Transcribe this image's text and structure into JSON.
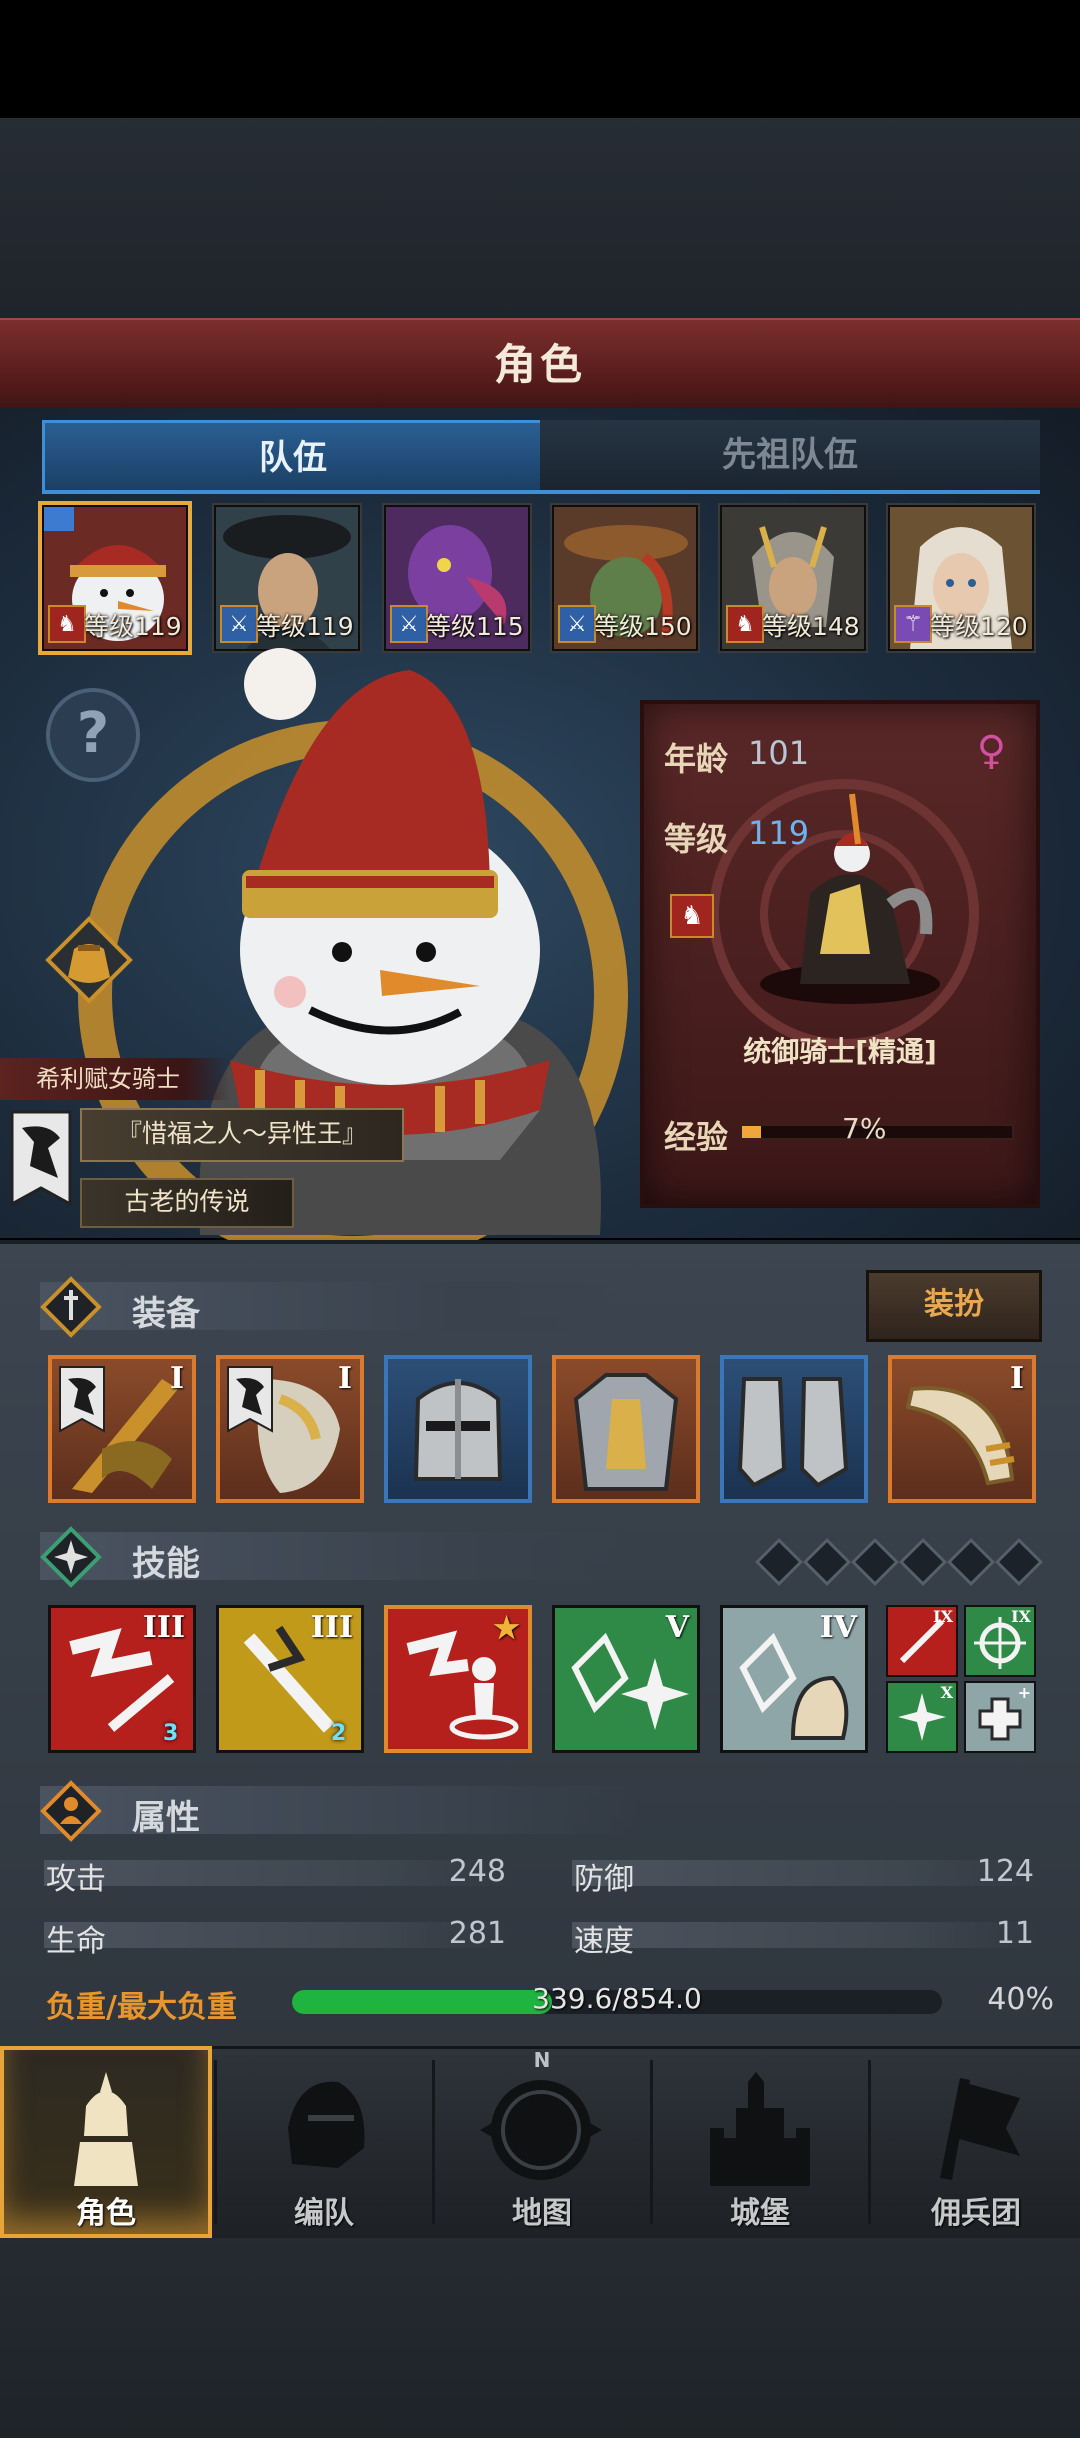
{
  "header": {
    "title": "角色"
  },
  "tabs": [
    {
      "label": "队伍",
      "active": true
    },
    {
      "label": "先祖队伍",
      "active": false
    }
  ],
  "team": [
    {
      "level_label": "等级119",
      "class_icon": "horse-icon",
      "selected": true
    },
    {
      "level_label": "等级119",
      "class_icon": "sword-icon"
    },
    {
      "level_label": "等级115",
      "class_icon": "sword-icon"
    },
    {
      "level_label": "等级150",
      "class_icon": "sword-icon"
    },
    {
      "level_label": "等级148",
      "class_icon": "horse-icon"
    },
    {
      "level_label": "等级120",
      "class_icon": "staff-icon"
    }
  ],
  "hero": {
    "class_name": "希利赋女骑士",
    "title": "『惜福之人～异性王』",
    "subtitle": "古老的传说",
    "age_label": "年龄",
    "age": "101",
    "level_label": "等级",
    "level": "119",
    "gender_icon": "female-icon",
    "unit_class": "统御骑士[精通]",
    "exp_label": "经验",
    "exp_percent": "7%",
    "exp_fraction": 0.07
  },
  "equipment": {
    "label": "装备",
    "dress_button": "装扮",
    "slots": [
      {
        "name": "weapon-slot",
        "tier": "I",
        "rarity": "orange"
      },
      {
        "name": "offhand-slot",
        "tier": "I",
        "rarity": "orange"
      },
      {
        "name": "helmet-slot",
        "tier": "",
        "rarity": "blue"
      },
      {
        "name": "armor-slot",
        "tier": "",
        "rarity": "orange"
      },
      {
        "name": "boots-slot",
        "tier": "",
        "rarity": "blue"
      },
      {
        "name": "horn-slot",
        "tier": "I",
        "rarity": "orange"
      }
    ]
  },
  "skills": {
    "label": "技能",
    "slot_count": 6,
    "items": [
      {
        "tier": "III",
        "count": "3",
        "color": "#b5201c"
      },
      {
        "tier": "III",
        "count": "2",
        "color": "#c29a1a"
      },
      {
        "tier": "",
        "count": "",
        "color": "#b5201c",
        "selected": true
      },
      {
        "tier": "V",
        "count": "",
        "color": "#2f8a47"
      },
      {
        "tier": "IV",
        "count": "",
        "color": "#8fa6a8"
      }
    ],
    "mini": [
      {
        "tier": "IX",
        "color": "#b5201c"
      },
      {
        "tier": "IX",
        "color": "#2f8a47"
      },
      {
        "tier": "X",
        "color": "#2f8a47"
      },
      {
        "tier": "+",
        "color": "#8fa6a8"
      }
    ]
  },
  "attributes": {
    "label": "属性",
    "attack_label": "攻击",
    "attack": "248",
    "defense_label": "防御",
    "defense": "124",
    "hp_label": "生命",
    "hp": "281",
    "speed_label": "速度",
    "speed": "11",
    "weight_label": "负重/最大负重",
    "weight_value": "339.6/854.0",
    "weight_percent": "40%",
    "weight_fraction": 0.4
  },
  "nav": [
    {
      "label": "角色",
      "icon": "knight-icon",
      "active": true
    },
    {
      "label": "编队",
      "icon": "helmet-icon"
    },
    {
      "label": "地图",
      "icon": "compass-icon",
      "compass_n": "N"
    },
    {
      "label": "城堡",
      "icon": "castle-icon"
    },
    {
      "label": "佣兵团",
      "icon": "banner-icon"
    }
  ],
  "colors": {
    "accent_gold": "#e7a438",
    "tab_blue": "#3f8fd6",
    "weight_green": "#1fb340",
    "exp_orange": "#f0a63a"
  }
}
